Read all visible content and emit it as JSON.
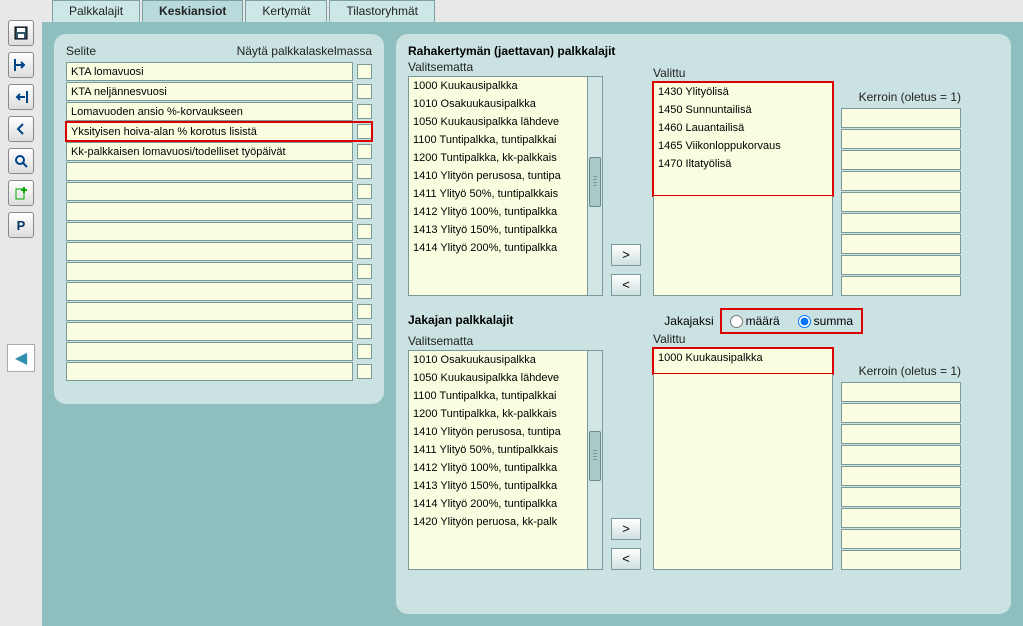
{
  "tabs": [
    "Palkkalajit",
    "Keskiansiot",
    "Kertymät",
    "Tilastoryhmät"
  ],
  "active_tab": 1,
  "left": {
    "header_left": "Selite",
    "header_right": "Näytä palkkalaskelmassa",
    "rows": [
      "KTA lomavuosi",
      "KTA neljännesvuosi",
      "Lomavuoden ansio %-korvaukseen",
      "Yksityisen hoiva-alan % korotus lisistä",
      "Kk-palkkaisen lomavuosi/todelliset työpäivät",
      "",
      "",
      "",
      "",
      "",
      "",
      "",
      "",
      "",
      "",
      ""
    ],
    "highlight_index": 3
  },
  "section1": {
    "title": "Rahakertymän (jaettavan) palkkalajit",
    "label_left": "Valitsematta",
    "label_right": "Valittu",
    "label_kerroin": "Kerroin (oletus = 1)",
    "left_items": [
      "1000 Kuukausipalkka",
      "1010 Osakuukausipalkka",
      "1050 Kuukausipalkka lähdeve",
      "1100 Tuntipalkka, tuntipalkkai",
      "1200 Tuntipalkka, kk-palkkais",
      "1410 Ylityön perusosa, tuntipa",
      "1411 Ylityö 50%, tuntipalkkais",
      "1412 Ylityö 100%, tuntipalkka",
      "1413 Ylityö 150%, tuntipalkka",
      "1414 Ylityö 200%, tuntipalkka"
    ],
    "right_items": [
      "1430 Ylityölisä",
      "1450 Sunnuntailisä",
      "1460 Lauantailisä",
      "1465 Viikonloppukorvaus",
      "1470 Iltatyölisä"
    ],
    "btn_add": ">",
    "btn_remove": "<",
    "kerroin_rows": 9
  },
  "section2": {
    "title": "Jakajan palkkalajit",
    "jakajaksi": "Jakajaksi",
    "opt1": "määrä",
    "opt2": "summa",
    "selected_opt": "summa",
    "label_left": "Valitsematta",
    "label_right": "Valittu",
    "label_kerroin": "Kerroin (oletus = 1)",
    "left_items": [
      "1010 Osakuukausipalkka",
      "1050 Kuukausipalkka lähdeve",
      "1100 Tuntipalkka, tuntipalkkai",
      "1200 Tuntipalkka, kk-palkkais",
      "1410 Ylityön perusosa, tuntipa",
      "1411 Ylityö 50%, tuntipalkkais",
      "1412 Ylityö 100%, tuntipalkka",
      "1413 Ylityö 150%, tuntipalkka",
      "1414 Ylityö 200%, tuntipalkka",
      "1420 Ylityön peruosa, kk-palk"
    ],
    "right_items": [
      "1000 Kuukausipalkka"
    ],
    "btn_add": ">",
    "btn_remove": "<",
    "kerroin_rows": 9
  }
}
